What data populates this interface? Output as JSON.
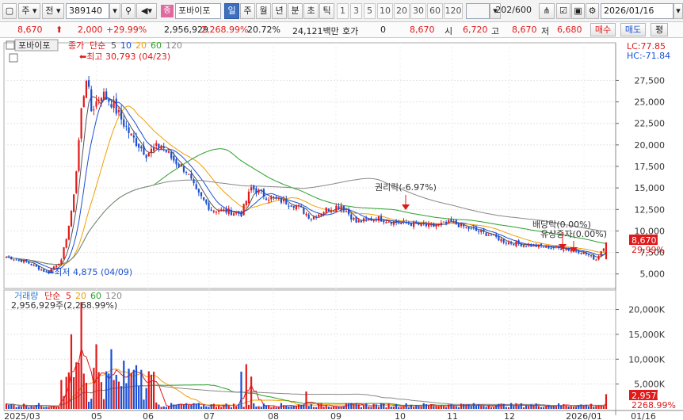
{
  "toolbar": {
    "market": "주",
    "type": "전",
    "code": "389140",
    "tag": "종",
    "name": "포바이포",
    "periods": [
      "일",
      "주",
      "월",
      "년",
      "분",
      "초",
      "틱"
    ],
    "active_period": "일",
    "num_buttons": [
      "1",
      "3",
      "5",
      "10",
      "20",
      "30",
      "60",
      "120"
    ],
    "count": "202",
    "max": "/600",
    "date": "2026/01/16"
  },
  "quote": {
    "price": "8,670",
    "change": "2,000",
    "change_pct": "+29.99%",
    "volume": "2,956,929",
    "volume_pct": "2,268.99%",
    "turnover": "20.72%",
    "amount": "24,121백만",
    "hoga_label": "호가",
    "hoga": "0",
    "hoga_price": "8,670",
    "open_label": "시",
    "open": "6,720",
    "high_label": "고",
    "high": "8,670",
    "low_label": "저",
    "low": "6,680",
    "buy": "매수",
    "sell": "매도",
    "flat": "평"
  },
  "chart_data": [
    {
      "type": "candlestick",
      "name": "포바이포",
      "legend": [
        "종가",
        "단순",
        "5",
        "10",
        "20",
        "60",
        "120"
      ],
      "legend_colors": [
        "#e0191a",
        "#e0191a",
        "#555555",
        "#1a4fd1",
        "#f0a000",
        "#2aa02a",
        "#888888"
      ],
      "y_ticks": [
        5000,
        7500,
        10000,
        12500,
        15000,
        17500,
        20000,
        22500,
        25000,
        27500
      ],
      "ylim": [
        3500,
        31500
      ],
      "lc": "LC:77.85",
      "hc": "HC:-71.84",
      "last_price_label": "8,670",
      "last_pct_label": "29.99%",
      "annotations": {
        "high": "최고 30,793 (04/23)",
        "low": "최저 4,875 (04/09)",
        "rights": "권리락(-6.97%)",
        "dividend": "배당락(0.00%)",
        "paid_in": "유상증자(0.00%)"
      },
      "anchors": [
        [
          0,
          7000
        ],
        [
          8,
          6400
        ],
        [
          12,
          5800
        ],
        [
          16,
          5200
        ],
        [
          22,
          6500
        ],
        [
          26,
          12000
        ],
        [
          28,
          17000
        ],
        [
          30,
          24000
        ],
        [
          32,
          28000
        ],
        [
          34,
          24000
        ],
        [
          38,
          26000
        ],
        [
          42,
          25000
        ],
        [
          46,
          23000
        ],
        [
          50,
          21000
        ],
        [
          56,
          19000
        ],
        [
          62,
          20000
        ],
        [
          66,
          18500
        ],
        [
          72,
          17000
        ],
        [
          76,
          14500
        ],
        [
          82,
          12500
        ],
        [
          88,
          12300
        ],
        [
          94,
          12000
        ],
        [
          98,
          15000
        ],
        [
          104,
          14000
        ],
        [
          110,
          13500
        ],
        [
          116,
          13000
        ],
        [
          122,
          11500
        ],
        [
          128,
          12500
        ],
        [
          134,
          13000
        ],
        [
          140,
          11000
        ],
        [
          148,
          11500
        ],
        [
          156,
          11000
        ],
        [
          164,
          10800
        ],
        [
          170,
          10500
        ],
        [
          178,
          11000
        ],
        [
          186,
          10200
        ],
        [
          194,
          9500
        ],
        [
          200,
          8700
        ],
        [
          210,
          8300
        ],
        [
          222,
          8000
        ],
        [
          230,
          7600
        ],
        [
          236,
          6700
        ],
        [
          240,
          8670
        ]
      ],
      "x_labels": [
        "2025/03",
        "05",
        "06",
        "07",
        "08",
        "09",
        "10",
        "11",
        "12",
        "2026/01",
        "01/16"
      ]
    },
    {
      "type": "bar",
      "name": "거래량",
      "legend": [
        "거래량",
        "단순",
        "5",
        "20",
        "60",
        "120"
      ],
      "legend_colors": [
        "#2e7bd6",
        "#e0191a",
        "#e0191a",
        "#f0a000",
        "#2aa02a",
        "#888888"
      ],
      "value_label": "2,956,929주(2,268.99%)",
      "y_ticks": [
        5000,
        10000,
        15000,
        20000
      ],
      "y_tick_labels": [
        "5,000K",
        "10,000K",
        "15,000K",
        "20,000K"
      ],
      "ylim": [
        0,
        22000
      ],
      "last_label": "2,957K",
      "last_pct_label": "2268.99%"
    }
  ]
}
